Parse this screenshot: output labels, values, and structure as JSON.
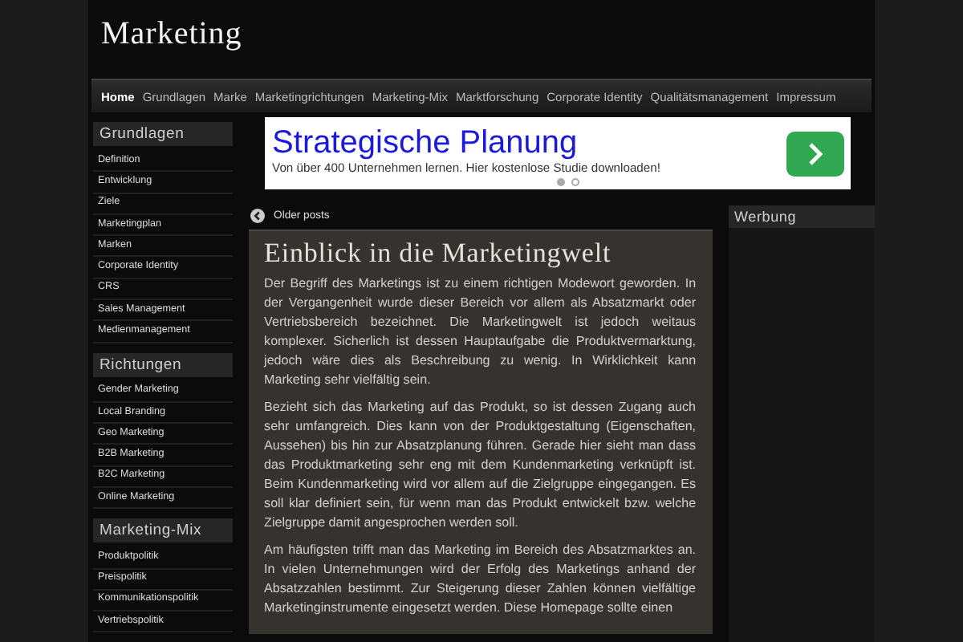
{
  "site_title": "Marketing",
  "nav": [
    {
      "label": "Home",
      "selected": true
    },
    {
      "label": "Grundlagen",
      "selected": false
    },
    {
      "label": "Marke",
      "selected": false
    },
    {
      "label": "Marketingrichtungen",
      "selected": false
    },
    {
      "label": "Marketing-Mix",
      "selected": false
    },
    {
      "label": "Marktforschung",
      "selected": false
    },
    {
      "label": "Corporate Identity",
      "selected": false
    },
    {
      "label": "Qualitätsmanagement",
      "selected": false
    },
    {
      "label": "Impressum",
      "selected": false
    }
  ],
  "sidebar": [
    {
      "title": "Grundlagen",
      "items": [
        "Definition",
        "Entwicklung",
        "Ziele",
        "Marketingplan",
        "Marken",
        "Corporate Identity",
        "CRS",
        "Sales Management",
        "Medienmanagement"
      ]
    },
    {
      "title": "Richtungen",
      "items": [
        "Gender Marketing",
        "Local Branding",
        "Geo Marketing",
        "B2B Marketing",
        "B2C Marketing",
        "Online Marketing"
      ]
    },
    {
      "title": "Marketing-Mix",
      "items": [
        "Produktpolitik",
        "Preispolitik",
        "Kommunikationspolitik",
        "Vertriebspolitik"
      ]
    }
  ],
  "ad": {
    "headline": "Strategische Planung",
    "text": "Von über 400 Unternehmen lernen. Hier kostenlose Studie downloaden!",
    "slides": [
      {
        "selected": true
      },
      {
        "selected": false
      }
    ]
  },
  "older_posts": "Older posts",
  "post": {
    "title": "Einblick in die Marketingwelt",
    "paragraphs": [
      "Der Begriff des Marketings ist zu einem richtigen Modewort geworden. In der Vergangenheit wurde dieser Bereich vor allem als Absatzmarkt oder Vertriebsbereich bezeichnet.  Die Marketingwelt ist jedoch weitaus komplexer. Sicherlich ist dessen Hauptaufgabe die Produktvermarktung, jedoch wäre dies als Beschreibung zu wenig. In Wirklichkeit  kann Marketing sehr vielfältig sein.",
      "Bezieht sich das Marketing auf das Produkt, so ist dessen Zugang auch sehr umfangreich. Dies kann von der Produktgestaltung (Eigenschaften, Aussehen) bis hin zur Absatzplanung führen. Gerade hier sieht man dass das Produktmarketing sehr eng mit dem Kundenmarketing verknüpft ist. Beim Kundenmarketing wird vor allem auf die Zielgruppe eingegangen. Es soll klar definiert sein, für wenn man das Produkt entwickelt bzw. welche Zielgruppe damit angesprochen werden soll.",
      "Am häufigsten trifft man das Marketing im Bereich des Absatzmarktes an. In vielen Unternehmungen wird der Erfolg des Marketings anhand der Absatzzahlen bestimmt. Zur Steigerung dieser Zahlen können vielfältige Marketinginstrumente eingesetzt werden. Diese Homepage sollte einen"
    ]
  },
  "widget": {
    "title": "Werbung"
  }
}
